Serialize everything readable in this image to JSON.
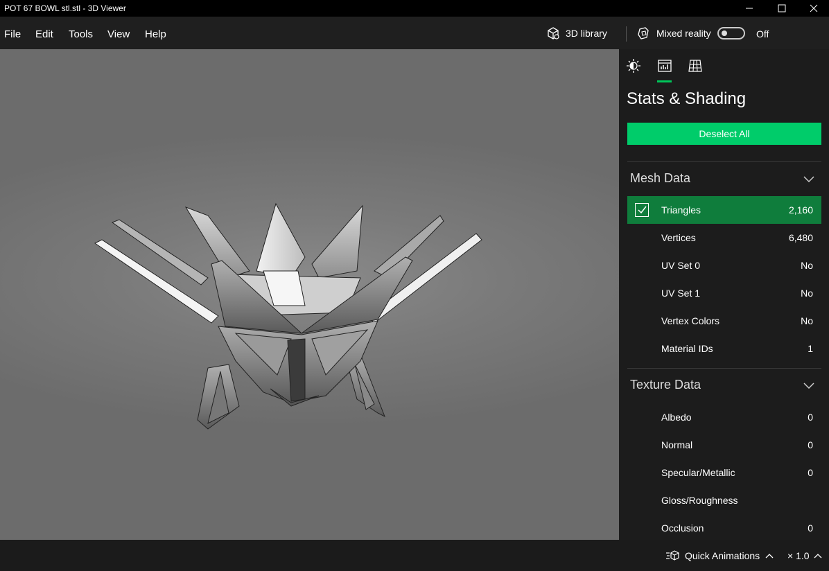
{
  "window": {
    "title": "POT 67 BOWL stl.stl - 3D Viewer",
    "minimize_icon": "minimize-icon",
    "maximize_icon": "maximize-icon",
    "close_icon": "close-icon"
  },
  "menu": {
    "items": [
      "File",
      "Edit",
      "Tools",
      "View",
      "Help"
    ],
    "library_label": "3D library",
    "library_icon": "cube-icon",
    "mixed_reality_label": "Mixed reality",
    "mixed_reality_icon": "mixed-reality-icon",
    "mixed_reality_state": "Off"
  },
  "panel": {
    "tabs": [
      {
        "icon": "lighting-icon",
        "selected": false
      },
      {
        "icon": "stats-icon",
        "selected": true
      },
      {
        "icon": "grid-icon",
        "selected": false
      }
    ],
    "title": "Stats & Shading",
    "deselect_label": "Deselect All",
    "accent": "#00cc6a",
    "selected_row_color": "#0f7d3c",
    "mesh_section": {
      "label": "Mesh Data",
      "rows": [
        {
          "label": "Triangles",
          "value": "2,160",
          "checked": true
        },
        {
          "label": "Vertices",
          "value": "6,480"
        },
        {
          "label": "UV Set 0",
          "value": "No"
        },
        {
          "label": "UV Set 1",
          "value": "No"
        },
        {
          "label": "Vertex Colors",
          "value": "No"
        },
        {
          "label": "Material IDs",
          "value": "1"
        }
      ]
    },
    "texture_section": {
      "label": "Texture Data",
      "rows": [
        {
          "label": "Albedo",
          "value": "0"
        },
        {
          "label": "Normal",
          "value": "0"
        },
        {
          "label": "Specular/Metallic",
          "value": "0"
        },
        {
          "label": "Gloss/Roughness",
          "value": ""
        },
        {
          "label": "Occlusion",
          "value": "0"
        }
      ]
    }
  },
  "statusbar": {
    "quick_animations_label": "Quick Animations",
    "zoom_label": "× 1.0"
  }
}
